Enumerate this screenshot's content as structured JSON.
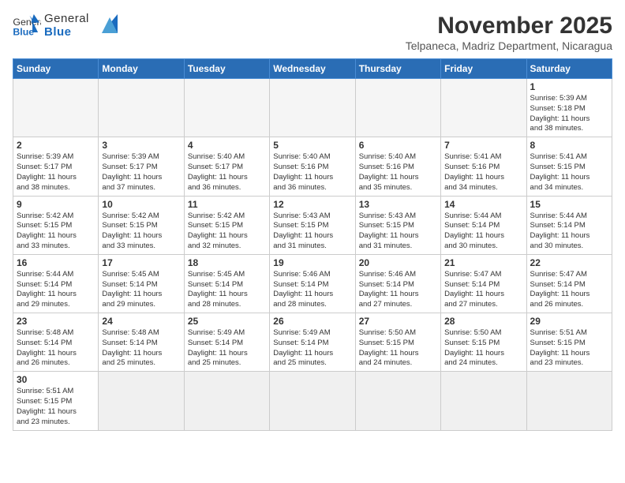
{
  "header": {
    "logo_general": "General",
    "logo_blue": "Blue",
    "month_title": "November 2025",
    "subtitle": "Telpaneca, Madriz Department, Nicaragua"
  },
  "weekdays": [
    "Sunday",
    "Monday",
    "Tuesday",
    "Wednesday",
    "Thursday",
    "Friday",
    "Saturday"
  ],
  "days": [
    {
      "date": "",
      "info": ""
    },
    {
      "date": "",
      "info": ""
    },
    {
      "date": "",
      "info": ""
    },
    {
      "date": "",
      "info": ""
    },
    {
      "date": "",
      "info": ""
    },
    {
      "date": "",
      "info": ""
    },
    {
      "date": "1",
      "info": "Sunrise: 5:39 AM\nSunset: 5:18 PM\nDaylight: 11 hours\nand 38 minutes."
    },
    {
      "date": "2",
      "info": "Sunrise: 5:39 AM\nSunset: 5:17 PM\nDaylight: 11 hours\nand 38 minutes."
    },
    {
      "date": "3",
      "info": "Sunrise: 5:39 AM\nSunset: 5:17 PM\nDaylight: 11 hours\nand 37 minutes."
    },
    {
      "date": "4",
      "info": "Sunrise: 5:40 AM\nSunset: 5:17 PM\nDaylight: 11 hours\nand 36 minutes."
    },
    {
      "date": "5",
      "info": "Sunrise: 5:40 AM\nSunset: 5:16 PM\nDaylight: 11 hours\nand 36 minutes."
    },
    {
      "date": "6",
      "info": "Sunrise: 5:40 AM\nSunset: 5:16 PM\nDaylight: 11 hours\nand 35 minutes."
    },
    {
      "date": "7",
      "info": "Sunrise: 5:41 AM\nSunset: 5:16 PM\nDaylight: 11 hours\nand 34 minutes."
    },
    {
      "date": "8",
      "info": "Sunrise: 5:41 AM\nSunset: 5:15 PM\nDaylight: 11 hours\nand 34 minutes."
    },
    {
      "date": "9",
      "info": "Sunrise: 5:42 AM\nSunset: 5:15 PM\nDaylight: 11 hours\nand 33 minutes."
    },
    {
      "date": "10",
      "info": "Sunrise: 5:42 AM\nSunset: 5:15 PM\nDaylight: 11 hours\nand 33 minutes."
    },
    {
      "date": "11",
      "info": "Sunrise: 5:42 AM\nSunset: 5:15 PM\nDaylight: 11 hours\nand 32 minutes."
    },
    {
      "date": "12",
      "info": "Sunrise: 5:43 AM\nSunset: 5:15 PM\nDaylight: 11 hours\nand 31 minutes."
    },
    {
      "date": "13",
      "info": "Sunrise: 5:43 AM\nSunset: 5:15 PM\nDaylight: 11 hours\nand 31 minutes."
    },
    {
      "date": "14",
      "info": "Sunrise: 5:44 AM\nSunset: 5:14 PM\nDaylight: 11 hours\nand 30 minutes."
    },
    {
      "date": "15",
      "info": "Sunrise: 5:44 AM\nSunset: 5:14 PM\nDaylight: 11 hours\nand 30 minutes."
    },
    {
      "date": "16",
      "info": "Sunrise: 5:44 AM\nSunset: 5:14 PM\nDaylight: 11 hours\nand 29 minutes."
    },
    {
      "date": "17",
      "info": "Sunrise: 5:45 AM\nSunset: 5:14 PM\nDaylight: 11 hours\nand 29 minutes."
    },
    {
      "date": "18",
      "info": "Sunrise: 5:45 AM\nSunset: 5:14 PM\nDaylight: 11 hours\nand 28 minutes."
    },
    {
      "date": "19",
      "info": "Sunrise: 5:46 AM\nSunset: 5:14 PM\nDaylight: 11 hours\nand 28 minutes."
    },
    {
      "date": "20",
      "info": "Sunrise: 5:46 AM\nSunset: 5:14 PM\nDaylight: 11 hours\nand 27 minutes."
    },
    {
      "date": "21",
      "info": "Sunrise: 5:47 AM\nSunset: 5:14 PM\nDaylight: 11 hours\nand 27 minutes."
    },
    {
      "date": "22",
      "info": "Sunrise: 5:47 AM\nSunset: 5:14 PM\nDaylight: 11 hours\nand 26 minutes."
    },
    {
      "date": "23",
      "info": "Sunrise: 5:48 AM\nSunset: 5:14 PM\nDaylight: 11 hours\nand 26 minutes."
    },
    {
      "date": "24",
      "info": "Sunrise: 5:48 AM\nSunset: 5:14 PM\nDaylight: 11 hours\nand 25 minutes."
    },
    {
      "date": "25",
      "info": "Sunrise: 5:49 AM\nSunset: 5:14 PM\nDaylight: 11 hours\nand 25 minutes."
    },
    {
      "date": "26",
      "info": "Sunrise: 5:49 AM\nSunset: 5:14 PM\nDaylight: 11 hours\nand 25 minutes."
    },
    {
      "date": "27",
      "info": "Sunrise: 5:50 AM\nSunset: 5:15 PM\nDaylight: 11 hours\nand 24 minutes."
    },
    {
      "date": "28",
      "info": "Sunrise: 5:50 AM\nSunset: 5:15 PM\nDaylight: 11 hours\nand 24 minutes."
    },
    {
      "date": "29",
      "info": "Sunrise: 5:51 AM\nSunset: 5:15 PM\nDaylight: 11 hours\nand 23 minutes."
    },
    {
      "date": "30",
      "info": "Sunrise: 5:51 AM\nSunset: 5:15 PM\nDaylight: 11 hours\nand 23 minutes."
    }
  ]
}
